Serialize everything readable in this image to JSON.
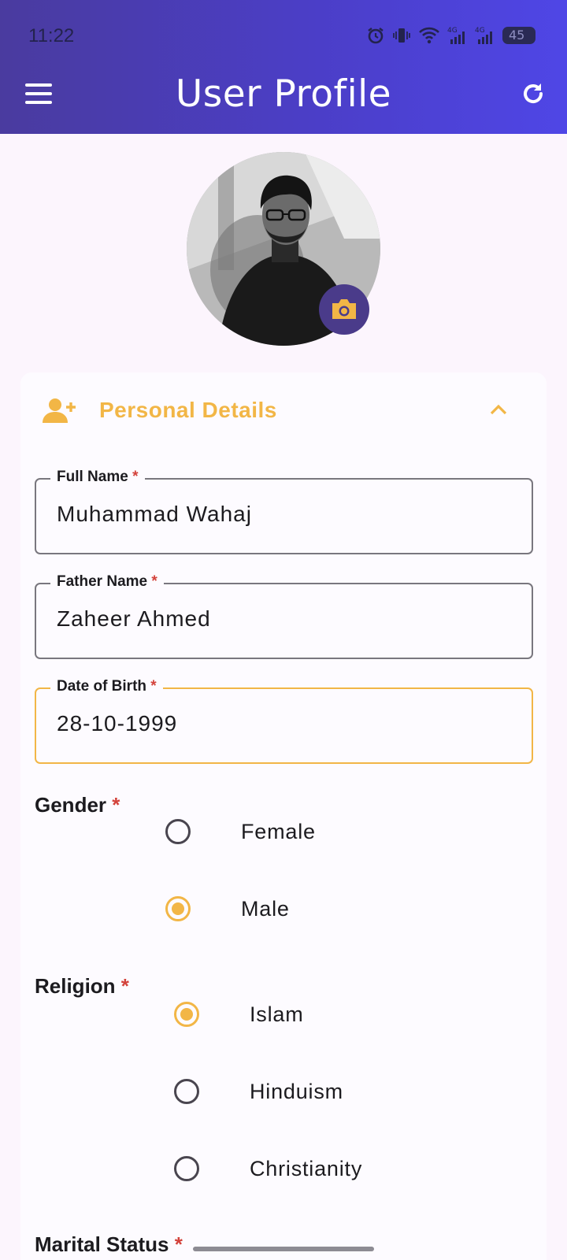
{
  "status_bar": {
    "time": "11:22",
    "icons": [
      "alarm-icon",
      "vibrate-icon",
      "wifi-icon",
      "signal-4g-icon",
      "signal-4g-icon",
      "battery-icon"
    ],
    "net1": "4G",
    "net2": "4G",
    "battery_level": "45"
  },
  "app_bar": {
    "title": "User Profile",
    "left_icon": "menu-icon",
    "right_icon": "refresh-icon",
    "colors": {
      "gradient_start": "#4a3b9f",
      "gradient_end": "#4f46e6"
    }
  },
  "profile": {
    "photo_icon": "camera-icon"
  },
  "section": {
    "title": "Personal Details",
    "icon": "person-add-icon",
    "toggle_icon": "chevron-up-icon",
    "accent": "#f2b646"
  },
  "fields": {
    "full_name": {
      "label": "Full Name",
      "required": "*",
      "value": "Muhammad Wahaj"
    },
    "father_name": {
      "label": "Father Name",
      "required": "*",
      "value": "Zaheer Ahmed"
    },
    "dob": {
      "label": "Date of Birth",
      "required": "*",
      "value": "28-10-1999"
    }
  },
  "gender": {
    "label": "Gender",
    "required": "*",
    "options": [
      "Female",
      "Male"
    ],
    "selected": "Male"
  },
  "religion": {
    "label": "Religion",
    "required": "*",
    "options": [
      "Islam",
      "Hinduism",
      "Christianity"
    ],
    "selected": "Islam"
  },
  "marital_status": {
    "label": "Marital Status",
    "required": "*"
  }
}
